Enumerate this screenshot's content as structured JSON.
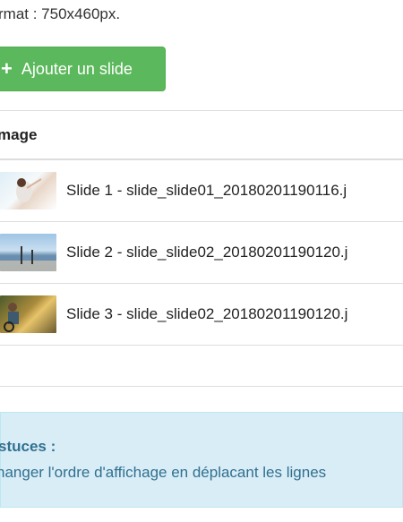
{
  "header": {
    "format_text": "rmat : 750x460px."
  },
  "toolbar": {
    "add_label": "Ajouter un slide",
    "add_icon": "plus-icon"
  },
  "table": {
    "column_header": "mage",
    "rows": [
      {
        "label": "Slide 1 - slide_slide01_20180201190116.j"
      },
      {
        "label": "Slide 2 - slide_slide02_20180201190120.j"
      },
      {
        "label": "Slide 3 - slide_slide02_20180201190120.j"
      }
    ]
  },
  "tips": {
    "title": "stuces :",
    "text": "hanger l'ordre d'affichage en déplacant les lignes"
  },
  "colors": {
    "button": "#5cb85c",
    "tips_bg": "#d9edf7",
    "tips_text": "#31708f"
  }
}
